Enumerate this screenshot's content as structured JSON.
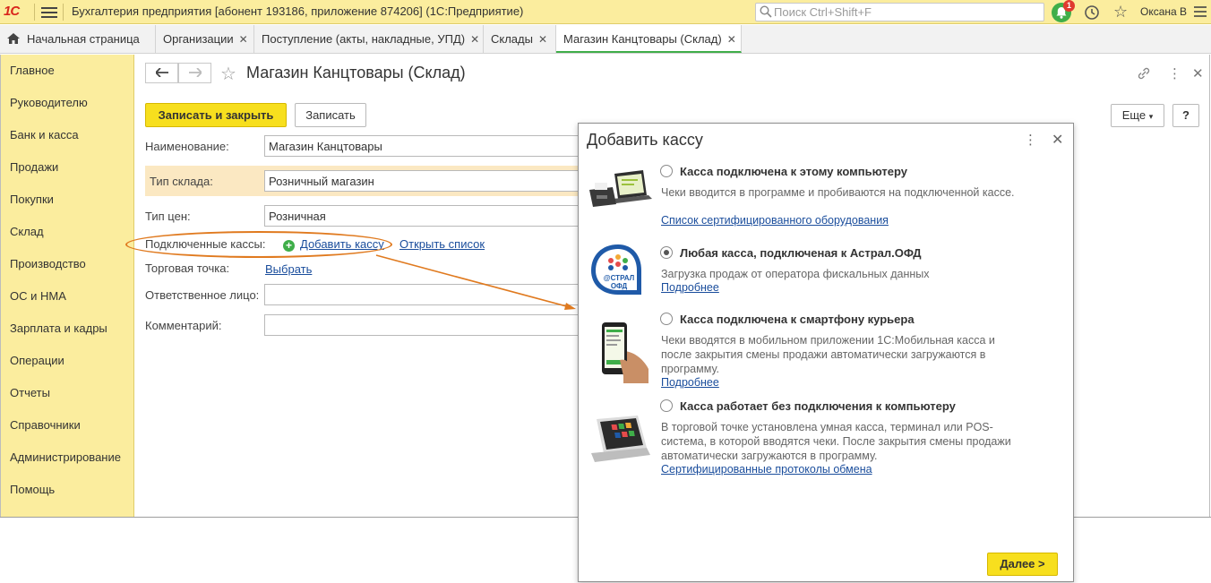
{
  "titlebar": {
    "logo": "1С",
    "app_title": "Бухгалтерия предприятия [абонент 193186, приложение 874206]  (1С:Предприятие)",
    "search_placeholder": "Поиск Ctrl+Shift+F",
    "notifications_count": "1",
    "user": "Оксана В"
  },
  "tabs": [
    {
      "label": "Начальная страница"
    },
    {
      "label": "Организации"
    },
    {
      "label": "Поступление (акты, накладные, УПД)"
    },
    {
      "label": "Склады"
    },
    {
      "label": "Магазин Канцтовары (Склад)"
    }
  ],
  "tab_close": "✕",
  "sidebar": {
    "items": [
      "Главное",
      "Руководителю",
      "Банк и касса",
      "Продажи",
      "Покупки",
      "Склад",
      "Производство",
      "ОС и НМА",
      "Зарплата и кадры",
      "Операции",
      "Отчеты",
      "Справочники",
      "Администрирование",
      "Помощь"
    ]
  },
  "form": {
    "title": "Магазин Канцтовары (Склад)",
    "save_close": "Записать и закрыть",
    "save": "Записать",
    "more": "Еще",
    "help": "?",
    "name_label": "Наименование:",
    "name_value": "Магазин Канцтовары",
    "type_label": "Тип склада:",
    "type_value": "Розничный магазин",
    "price_label": "Тип цен:",
    "price_value": "Розничная",
    "kkm_label": "Подключенные кассы:",
    "add_kkm": "Добавить кассу",
    "open_list": "Открыть список",
    "point_label": "Торговая точка:",
    "point_link": "Выбрать",
    "resp_label": "Ответственное лицо:",
    "resp_value": "",
    "comment_label": "Комментарий:",
    "comment_value": ""
  },
  "dialog": {
    "title": "Добавить кассу",
    "options": [
      {
        "title": "Касса подключена к этому компьютеру",
        "desc": "Чеки вводится в программе и пробиваются на подключенной кассе.",
        "link": "Список сертифицированного оборудования",
        "selected": false
      },
      {
        "title": "Любая касса, подключеная к Астрал.ОФД",
        "desc": "Загрузка продаж от оператора фискальных данных",
        "link": "Подробнее",
        "selected": true
      },
      {
        "title": "Касса подключена к смартфону курьера",
        "desc": "Чеки вводятся в мобильном приложении 1С:Мобильная касса и после закрытия смены продажи автоматически загружаются в программу.",
        "link": "Подробнее",
        "selected": false
      },
      {
        "title": "Касса работает без подключения к компьютеру",
        "desc": "В торговой точке установлена умная касса, терминал или POS-система, в которой вводятся чеки. После закрытия смены продажи автоматически загружаются в программу.",
        "link": "Сертифицированные протоколы обмена",
        "selected": false
      }
    ],
    "astral_logo_text": "@СТРАЛ ОФД",
    "next": "Далее >"
  },
  "colors": {
    "titlebar_bg": "#fbed9e",
    "sidebar_bg": "#fbed9e",
    "accent_yellow": "#f7df1e",
    "link_blue": "#1a4d9c",
    "annotation_orange": "#e07a1f",
    "highlight_row": "#fbe8c2",
    "green": "#3fae49"
  }
}
